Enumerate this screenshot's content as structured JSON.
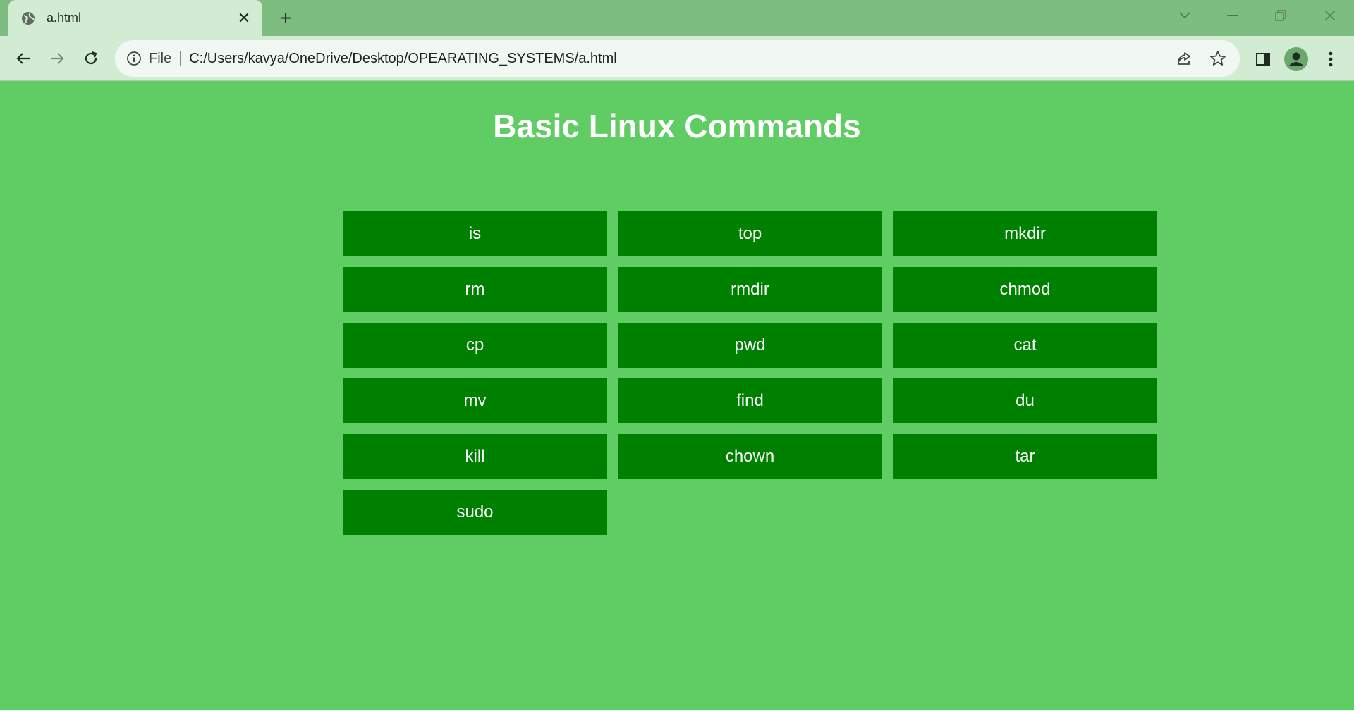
{
  "browser": {
    "tab_title": "a.html",
    "tab_close": "✕",
    "new_tab": "+",
    "address_scheme_label": "File",
    "address_url": "C:/Users/kavya/OneDrive/Desktop/OPEARATING_SYSTEMS/a.html",
    "colors": {
      "tabbar": "#7dbd7f",
      "toolbar": "#d2ebd3",
      "omnibox": "#f1f8f1"
    }
  },
  "page": {
    "title": "Basic Linux Commands",
    "background": "#5fcd64",
    "button_color": "#008000",
    "commands": [
      "is",
      "top",
      "mkdir",
      "rm",
      "rmdir",
      "chmod",
      "cp",
      "pwd",
      "cat",
      "mv",
      "find",
      "du",
      "kill",
      "chown",
      "tar",
      "sudo"
    ]
  }
}
